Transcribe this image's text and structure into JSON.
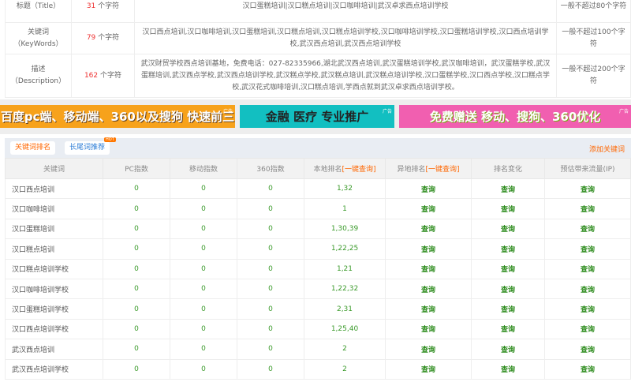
{
  "meta": {
    "rows": [
      {
        "label": "标题（Title）",
        "count": "31",
        "unit": "个字符",
        "content": "汉口蛋糕培训|汉口糕点培训|汉口咖啡培训|武汉卓求西点培训学校",
        "limit": "一般不超过80个字符"
      },
      {
        "label": "关键词（KeyWords）",
        "count": "79",
        "unit": "个字符",
        "content": "汉口西点培训,汉口咖啡培训,汉口蛋糕培训,汉口糕点培训,汉口糕点培训学校,汉口咖啡培训学校,汉口蛋糕培训学校,汉口西点培训学校,武汉西点培训,武汉西点培训学校",
        "limit": "一般不超过100个字符"
      },
      {
        "label": "描述（Description）",
        "count": "162",
        "unit": "个字符",
        "content": "武汉财贸学校西点培训基地，免费电话：027-82335966,湖北武汉西点培训,武汉蛋糕培训学校,武汉咖啡培训，武汉蛋糕学校,武汉蛋糕培训,武汉西点学校,武汉西点培训学校,武汉糕点学校,武汉糕点培训,武汉糕点培训学校,汉口蛋糕学校,汉口西点学校,汉口糕点学校,武汉花式咖啡培训,汉口糕点培训,学西点就到武汉卓求西点培训学校。",
        "limit": "一般不超过200个字符"
      }
    ]
  },
  "banners": [
    {
      "text": "百度pc端、移动端、360以及搜狗 快速前三",
      "ad": "广告",
      "color": "#f7a21b"
    },
    {
      "text": "金融 医疗 专业推广",
      "ad": "广告",
      "color": "#12bfc1"
    },
    {
      "text": "免费赠送 移动、搜狗、360优化",
      "ad": "广告",
      "color": "#f15fb0"
    }
  ],
  "tabs": {
    "active": "关键词排名",
    "second": "长尾词推荐",
    "badge": "HOT",
    "add": "添加关键词"
  },
  "table": {
    "headers": [
      "关键词",
      "PC指数",
      "移动指数",
      "360指数",
      "本地排名",
      "异地排名",
      "排名变化",
      "预估带来流量(IP)"
    ],
    "one_click": "[一键查询]",
    "query": "查询",
    "rows": [
      [
        "汉口西点培训",
        "0",
        "0",
        "0",
        "1,32"
      ],
      [
        "汉口咖啡培训",
        "0",
        "0",
        "0",
        "1"
      ],
      [
        "汉口蛋糕培训",
        "0",
        "0",
        "0",
        "1,30,39"
      ],
      [
        "汉口糕点培训",
        "0",
        "0",
        "0",
        "1,22,25"
      ],
      [
        "汉口糕点培训学校",
        "0",
        "0",
        "0",
        "1,21"
      ],
      [
        "汉口咖啡培训学校",
        "0",
        "0",
        "0",
        "1,22,32"
      ],
      [
        "汉口蛋糕培训学校",
        "0",
        "0",
        "0",
        "2,31"
      ],
      [
        "汉口西点培训学校",
        "0",
        "0",
        "0",
        "1,25,40"
      ],
      [
        "武汉西点培训",
        "0",
        "0",
        "0",
        "2"
      ],
      [
        "武汉西点培训学校",
        "0",
        "0",
        "0",
        "2"
      ]
    ]
  }
}
